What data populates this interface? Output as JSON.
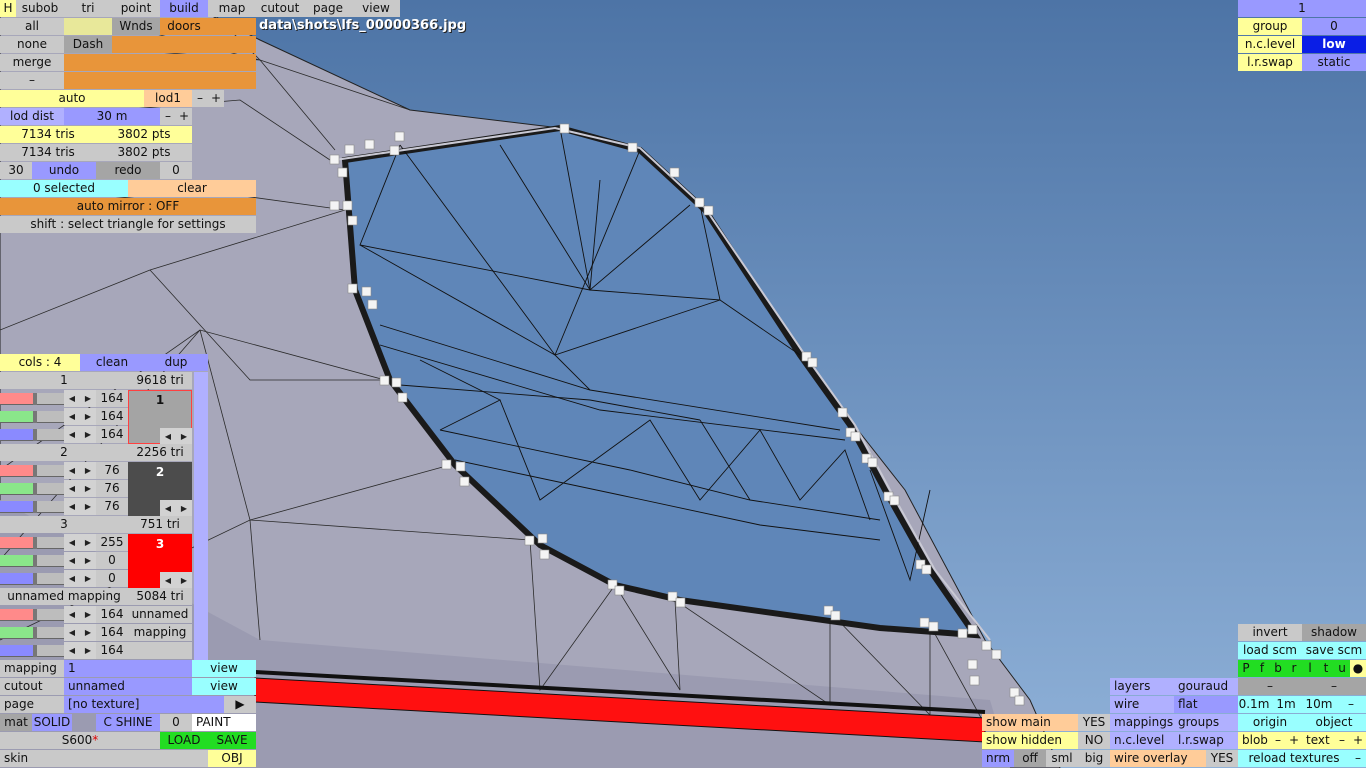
{
  "file_path": "data\\shots\\lfs_00000366.jpg",
  "top_tabs": {
    "h": "H",
    "subob": "subob",
    "tri": "tri",
    "point": "point",
    "build": "build",
    "map": "map",
    "cutout": "cutout",
    "page": "page",
    "view": "view"
  },
  "select": {
    "all": "all",
    "none": "none",
    "merge": "merge",
    "minus": "–",
    "wnds": "Wnds",
    "doors": "doors",
    "dash": "Dash"
  },
  "lod": {
    "auto": "auto",
    "lod1": "lod1",
    "minus": "–",
    "plus": "+",
    "lod_dist_label": "lod dist",
    "lod_dist_value": "30 m",
    "dist_minus": "–",
    "dist_plus": "+"
  },
  "stats": {
    "tris_a": "7134 tris",
    "pts_a": "3802 pts",
    "tris_b": "7134 tris",
    "pts_b": "3802 pts",
    "undo_count": "30",
    "undo": "undo",
    "redo": "redo",
    "redo_count": "0"
  },
  "selection": {
    "selected": "0 selected",
    "clear": "clear",
    "auto_mirror": "auto mirror : OFF",
    "hint": "shift : select triangle for settings"
  },
  "cols": {
    "label": "cols : 4",
    "clean": "clean",
    "dup": "dup"
  },
  "colors": [
    {
      "name": "1",
      "tris": "9618 tri",
      "r": "164",
      "g": "164",
      "b": "164",
      "swatch": "1",
      "hex": "#a4a4a4",
      "text": "#111111"
    },
    {
      "name": "2",
      "tris": "2256 tri",
      "r": "76",
      "g": "76",
      "b": "76",
      "swatch": "2",
      "hex": "#4c4c4c",
      "text": "#ffffff"
    },
    {
      "name": "3",
      "tris": "751 tri",
      "r": "255",
      "g": "0",
      "b": "0",
      "swatch": "3",
      "hex": "#ff0000",
      "text": "#ffffff"
    }
  ],
  "unnamed_mapping": {
    "name": "unnamed mapping",
    "tris": "5084 tri",
    "r": "164",
    "g": "164",
    "b": "164",
    "line1": "unnamed",
    "line2": "mapping"
  },
  "bottom_left": {
    "mapping_label": "mapping",
    "mapping_value": "1",
    "mapping_view": "view",
    "cutout_label": "cutout",
    "cutout_value": "unnamed",
    "cutout_view": "view",
    "page_label": "page",
    "page_value": "[no texture]",
    "page_arrow": "▶",
    "mat": "mat",
    "solid": "SOLID",
    "c_shine": "C SHINE",
    "shine_value": "0",
    "paint": "PAINT",
    "model": "S600",
    "model_star": "*",
    "load": "LOAD",
    "save": "SAVE",
    "skin": "skin",
    "obj": "OBJ"
  },
  "top_right": {
    "number": "1",
    "group_label": "group",
    "group_value": "0",
    "nc_label": "n.c.level",
    "nc_value": "low",
    "lr_label": "l.r.swap",
    "lr_value": "static"
  },
  "bottom_right": {
    "invert": "invert",
    "shadow": "shadow",
    "load_scm": "load scm",
    "save_scm": "save scm",
    "flags": [
      "P",
      "f",
      "b",
      "r",
      "l",
      "t",
      "u",
      "●"
    ],
    "dash1": "–",
    "dash2": "–",
    "layers": "layers",
    "gouraud": "gouraud",
    "wire": "wire",
    "flat": "flat",
    "mappings": "mappings",
    "groups": "groups",
    "nc_level": "n.c.level",
    "lr_swap": "l.r.swap",
    "scale": [
      "0.1m",
      "1m",
      "10m",
      "–"
    ],
    "origin": "origin",
    "object": "object",
    "blob": "blob",
    "blob_minus": "–",
    "blob_plus": "+",
    "text": "text",
    "text_minus": "–",
    "text_plus": "+",
    "reload": "reload textures",
    "reload_minus": "–",
    "show_main": "show main",
    "show_main_value": "YES",
    "show_hidden": "show hidden",
    "show_hidden_value": "NO",
    "nrm": "nrm",
    "off": "off",
    "sml": "sml",
    "big": "big",
    "wire_overlay": "wire overlay",
    "wire_overlay_value": "YES"
  }
}
